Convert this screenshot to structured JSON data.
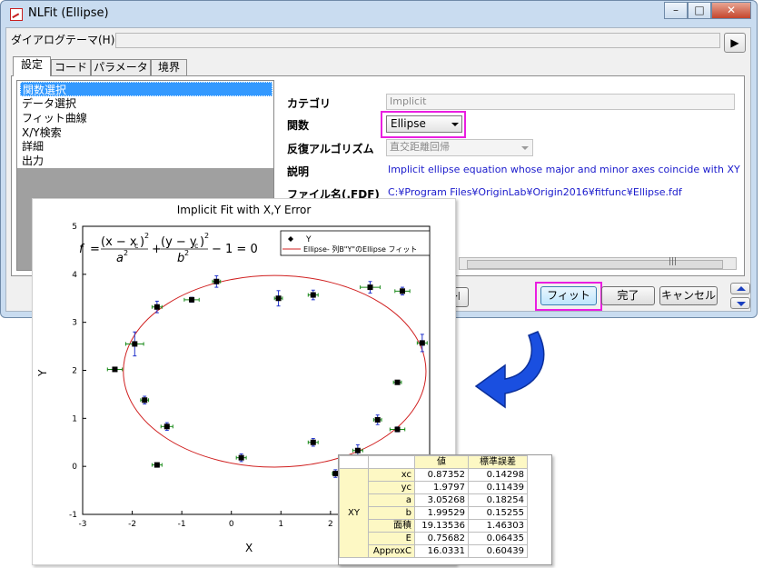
{
  "window": {
    "title": "NLFit (Ellipse)",
    "controls": {
      "minimize": "–",
      "maximize": "□",
      "close": "✕"
    }
  },
  "theme": {
    "label": "ダイアログテーマ(H)",
    "value": "",
    "arrow": "▶"
  },
  "tabs": [
    {
      "label": "設定",
      "active": true
    },
    {
      "label": "コード",
      "active": false
    },
    {
      "label": "パラメータ",
      "active": false
    },
    {
      "label": "境界",
      "active": false
    }
  ],
  "tree": {
    "items": [
      {
        "label": "関数選択",
        "selected": true
      },
      {
        "label": "データ選択",
        "selected": false
      },
      {
        "label": "フィット曲線",
        "selected": false
      },
      {
        "label": "X/Y検索",
        "selected": false
      },
      {
        "label": "詳細",
        "selected": false
      },
      {
        "label": "出力",
        "selected": false
      }
    ]
  },
  "properties": {
    "category": {
      "label": "カテゴリ",
      "value": "Implicit"
    },
    "function": {
      "label": "関数",
      "value": "Ellipse"
    },
    "iteration": {
      "label": "反復アルゴリズム",
      "value": "直交距離回帰"
    },
    "description": {
      "label": "説明",
      "value": "Implicit ellipse equation whose major and minor axes coincide with XY"
    },
    "file": {
      "label": "ファイル名(.FDF)",
      "value": "C:¥Program Files¥OriginLab¥Origin2016¥fitfunc¥Ellipse.fdf"
    }
  },
  "buttons": {
    "skip": "▸|",
    "fit": "フィット",
    "done": "完了",
    "cancel": "キャンセル"
  },
  "colors": {
    "highlight": "#ea1ee0",
    "accent_arrow": "#1a4fe0",
    "curve": "#d02020",
    "tree_selected": "#3399ff"
  },
  "graph": {
    "formula": "f = (x − xc)² / a² + (y − yc)² / b² − 1 = 0",
    "legend": [
      "Y",
      "Ellipse- 列B\"Y\"のEllipse フィット"
    ]
  },
  "chart_data": {
    "type": "scatter",
    "title": "Implicit Fit with X,Y Error",
    "xlabel": "X",
    "ylabel": "Y",
    "xlim": [
      -3,
      4
    ],
    "ylim": [
      -1,
      5
    ],
    "xticks": [
      -3,
      -2,
      -1,
      0,
      1,
      2,
      3
    ],
    "yticks": [
      -1,
      0,
      1,
      2,
      3,
      4,
      5
    ],
    "series": [
      {
        "name": "Y",
        "x": [
          -2.35,
          -1.95,
          -1.75,
          -1.5,
          -1.5,
          -1.3,
          -0.8,
          -0.3,
          0.2,
          0.95,
          1.65,
          1.65,
          2.1,
          2.55,
          2.8,
          2.95,
          3.35,
          3.35,
          3.45,
          3.85
        ],
        "y": [
          2.02,
          2.55,
          1.38,
          3.32,
          0.03,
          0.83,
          3.47,
          3.85,
          0.18,
          3.5,
          0.5,
          3.57,
          -0.15,
          0.33,
          3.73,
          0.97,
          0.77,
          1.75,
          3.65,
          2.57
        ],
        "xerr": [
          0.15,
          0.18,
          0.08,
          0.1,
          0.1,
          0.12,
          0.15,
          0.08,
          0.1,
          0.08,
          0.1,
          0.1,
          0.06,
          0.1,
          0.2,
          0.08,
          0.15,
          0.08,
          0.15,
          0.1
        ],
        "yerr": [
          0.04,
          0.25,
          0.08,
          0.12,
          0.04,
          0.08,
          0.05,
          0.12,
          0.08,
          0.16,
          0.08,
          0.1,
          0.08,
          0.12,
          0.12,
          0.1,
          0.05,
          0.04,
          0.08,
          0.18
        ]
      },
      {
        "name": "Ellipse- 列B\"Y\"のEllipse フィット",
        "type": "ellipse",
        "xc": 0.87352,
        "yc": 1.9797,
        "a": 3.05268,
        "b": 1.99529
      }
    ],
    "legend": "top-right"
  },
  "table": {
    "headers": [
      "値",
      "標準誤差"
    ],
    "group": "XY",
    "rows": [
      {
        "name": "xc",
        "value": "0.87352",
        "error": "0.14298"
      },
      {
        "name": "yc",
        "value": "1.9797",
        "error": "0.11439"
      },
      {
        "name": "a",
        "value": "3.05268",
        "error": "0.18254"
      },
      {
        "name": "b",
        "value": "1.99529",
        "error": "0.15255"
      },
      {
        "name": "面積",
        "value": "19.13536",
        "error": "1.46303"
      },
      {
        "name": "E",
        "value": "0.75682",
        "error": "0.06435"
      },
      {
        "name": "ApproxC",
        "value": "16.0331",
        "error": "0.60439"
      }
    ]
  }
}
